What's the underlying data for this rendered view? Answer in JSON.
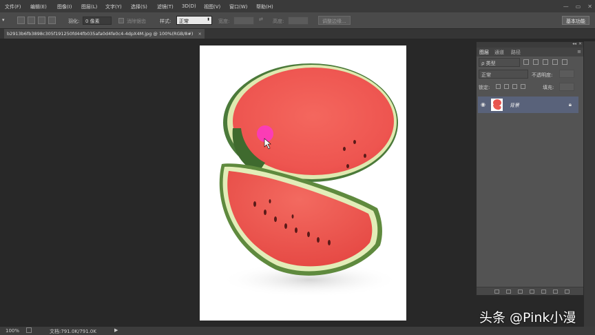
{
  "menu": {
    "items": [
      "文件(F)",
      "编辑(E)",
      "图像(I)",
      "图层(L)",
      "文字(Y)",
      "选择(S)",
      "滤镜(T)",
      "3D(D)",
      "视图(V)",
      "窗口(W)",
      "帮助(H)"
    ]
  },
  "options": {
    "feather_label": "羽化:",
    "feather_value": "0 像素",
    "antialias_label": "消除锯齿",
    "style_label": "样式:",
    "style_value": "正常",
    "width_label": "宽度:",
    "height_label": "高度:",
    "refine_edge": "调整边缘...",
    "workspace": "基本功能"
  },
  "document": {
    "tab_title": "b2913b6fb3898c305f191250fd44fb035afa0d4fe0c4-4dpX4M.jpg @ 100%(RGB/8#)",
    "tab_close": "×"
  },
  "layers_panel": {
    "tabs": [
      "图层",
      "通道",
      "路径"
    ],
    "filter_label": "ρ 类型",
    "blend_mode": "正常",
    "opacity_label": "不透明度:",
    "lock_label": "锁定:",
    "fill_label": "填充:",
    "layer_name": "背景"
  },
  "status": {
    "zoom": "100%",
    "doc_info": "文档:791.0K/791.0K"
  },
  "watermark": "头条 @Pink小漫",
  "colors": {
    "menubar": "#3a3a3a",
    "optionbar": "#4a4a4a",
    "workspace": "#282828",
    "panel": "#535353",
    "layer_selected": "#59627a"
  }
}
